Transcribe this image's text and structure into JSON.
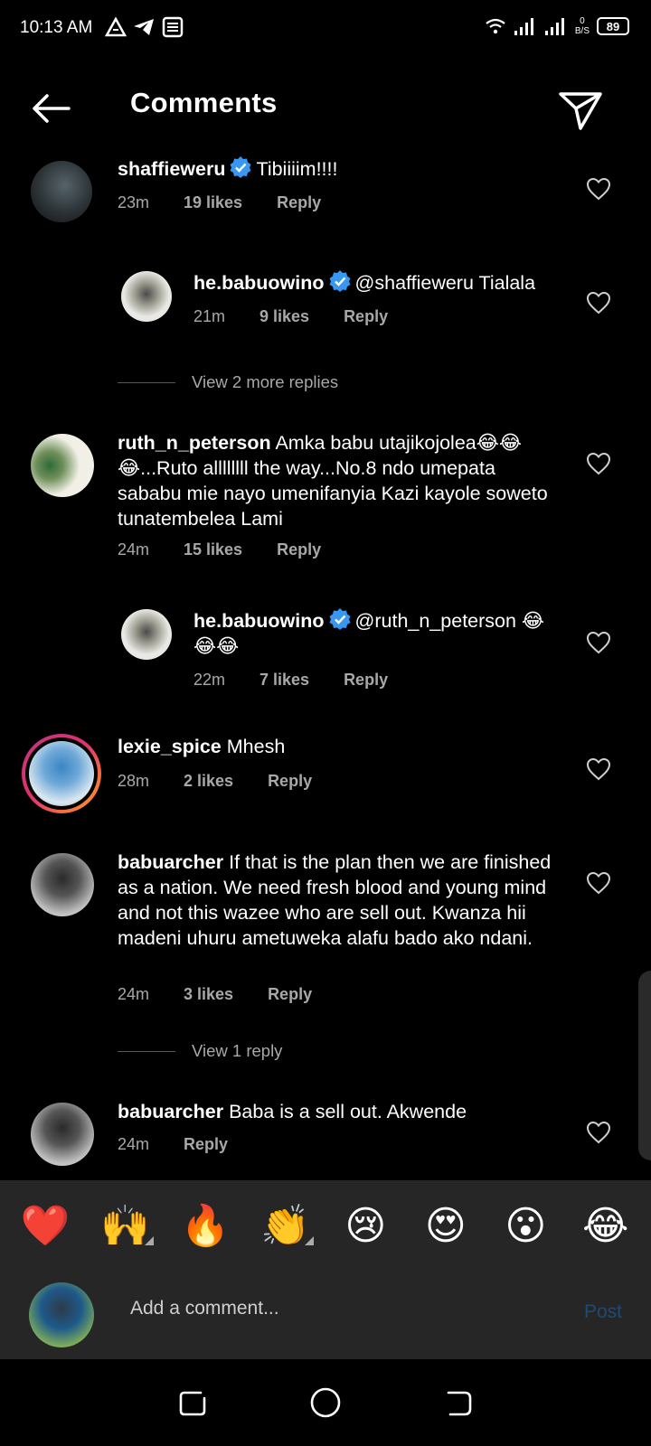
{
  "status_bar": {
    "time": "10:13 AM",
    "netspeed_value": "0",
    "netspeed_unit": "B/S",
    "battery": "89"
  },
  "header": {
    "title": "Comments"
  },
  "comments": [
    {
      "username": "shaffieweru",
      "verified": true,
      "text": "Tibiiiim!!!!",
      "time": "23m",
      "likes": "19 likes",
      "reply": "Reply"
    },
    {
      "username": "he.babuowino",
      "verified": true,
      "text": "@shaffieweru Tialala",
      "time": "21m",
      "likes": "9 likes",
      "reply": "Reply"
    },
    {
      "username": "ruth_n_peterson",
      "verified": false,
      "text": "Amka babu utajikojolea😂😂😂...Ruto allllllll the way...No.8 ndo umepata sababu mie nayo umenifanyia Kazi kayole soweto tunatembelea Lami",
      "time": "24m",
      "likes": "15 likes",
      "reply": "Reply"
    },
    {
      "username": "he.babuowino",
      "verified": true,
      "text": "@ruth_n_peterson 😂😂😂",
      "time": "22m",
      "likes": "7 likes",
      "reply": "Reply"
    },
    {
      "username": "lexie_spice",
      "verified": false,
      "text": "Mhesh",
      "time": "28m",
      "likes": "2 likes",
      "reply": "Reply"
    },
    {
      "username": "babuarcher",
      "verified": false,
      "text": "If that is the plan then we are finished as a nation. We need fresh blood and young mind and not this wazee who are sell out. Kwanza hii madeni uhuru ametuweka alafu bado ako ndani.",
      "time": "24m",
      "likes": "3 likes",
      "reply": "Reply"
    },
    {
      "username": "babuarcher",
      "verified": false,
      "text": "Baba is a sell out. Akwende",
      "time": "24m",
      "likes": "",
      "reply": "Reply"
    }
  ],
  "view_replies": [
    "View 2 more replies",
    "View 1 reply"
  ],
  "emoji_bar": [
    "❤️",
    "🙌",
    "🔥",
    "👏",
    "😢",
    "😍",
    "😮",
    "😂"
  ],
  "add_comment": {
    "placeholder": "Add a comment...",
    "post_label": "Post"
  },
  "colors": {
    "background": "#000000",
    "panel": "#262626",
    "muted_text": "#a8a8a8",
    "verified_blue": "#3897f0",
    "post_disabled": "#1d4b78"
  }
}
